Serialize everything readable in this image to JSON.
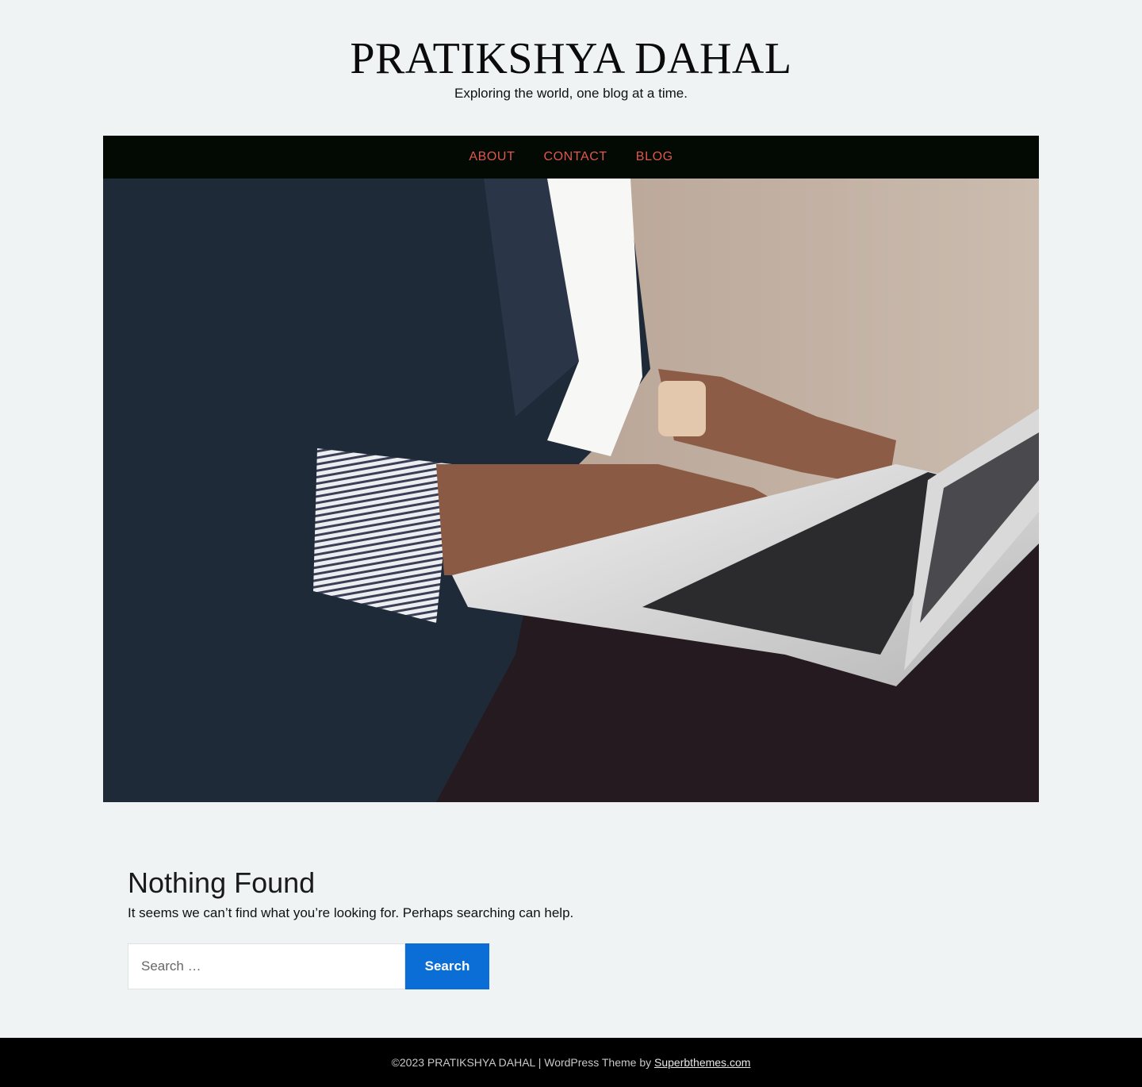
{
  "header": {
    "site_title": "PRATIKSHYA DAHAL",
    "tagline": "Exploring the world, one blog at a time."
  },
  "nav": {
    "items": [
      {
        "label": "ABOUT"
      },
      {
        "label": "CONTACT"
      },
      {
        "label": "BLOG"
      }
    ],
    "link_color": "#e0574b",
    "background": "#030a03"
  },
  "hero": {
    "image_description_icon": "hero-image"
  },
  "content": {
    "title": "Nothing Found",
    "message": "It seems we can’t find what you’re looking for. Perhaps searching can help."
  },
  "search": {
    "placeholder": "Search …",
    "value": "",
    "button_label": "Search",
    "button_color": "#0b6ed6"
  },
  "footer": {
    "copyright": "©2023 PRATIKSHYA DAHAL | WordPress Theme by ",
    "credit_link": "Superbthemes.com"
  }
}
